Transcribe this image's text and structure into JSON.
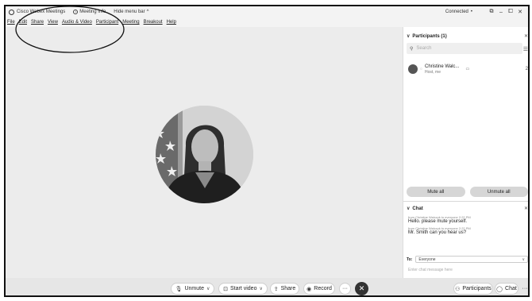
{
  "titlebar": {
    "app_name": "Cisco Webex Meetings",
    "meeting_info": "Meeting Info",
    "hide_menu": "Hide menu bar",
    "hide_menu_chevron": "^",
    "connection": "Connected",
    "connection_dot": "•",
    "window_controls": [
      "⧉",
      "–",
      "⧠",
      "✕"
    ]
  },
  "menubar": {
    "items": [
      "File",
      "Edit",
      "Share",
      "View",
      "Audio & Video",
      "Participant",
      "Meeting",
      "Breakout",
      "Help"
    ]
  },
  "participants": {
    "header": "Participants (1)",
    "close": "✕",
    "search_placeholder": "Search",
    "list": [
      {
        "name": "Christine Walc...",
        "role": "Host, me",
        "number": "2"
      }
    ],
    "mute_all": "Mute all",
    "unmute_all": "Unmute all"
  },
  "chat": {
    "header": "Chat",
    "close": "✕",
    "messages": [
      {
        "meta": "from Christine Walczyk to everyone   2:22 PM",
        "text": "Hello. please mute yourself."
      },
      {
        "meta": "from Christine Walczyk to everyone   2:22 PM",
        "text": "Mr. Smith can you hear us?"
      }
    ],
    "to_label": "To:",
    "to_value": "Everyone",
    "input_placeholder": "Enter chat message here"
  },
  "controls": {
    "unmute": "Unmute",
    "start_video": "Start video",
    "share": "Share",
    "record": "Record",
    "more": "···",
    "end": "✕",
    "participants": "Participants",
    "chat": "Chat",
    "more_right": "···"
  },
  "colors": {
    "stage_bg": "#ececec",
    "panel_bg": "#ffffff",
    "end_button": "#333333"
  }
}
